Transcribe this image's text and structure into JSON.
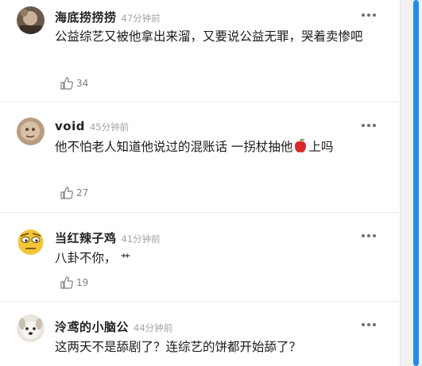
{
  "comments": [
    {
      "username": "海底捞捞捞",
      "time": "47分钟前",
      "text": "公益综艺又被他拿出来溜，又要说公益无罪，哭着卖惨吧",
      "likes": "34",
      "avatar_icon": "avatar-photo-icon"
    },
    {
      "username": "void",
      "time": "45分钟前",
      "text_before": "他不怕老人知道他说过的混账话 一拐杖抽他",
      "text_after": "上吗",
      "emoji": "apple-emoji",
      "likes": "27",
      "avatar_icon": "avatar-photo-icon"
    },
    {
      "username": "当红辣子鸡",
      "time": "41分钟前",
      "text": "八卦不你，",
      "text_extra": "艹",
      "likes": "19",
      "avatar_icon": "avatar-emoji-face-icon"
    },
    {
      "username": "泠鸢的小脑公",
      "time": "44分钟前",
      "text": "这两天不是舔剧了？连综艺的饼都开始舔了？",
      "avatar_icon": "avatar-dog-photo-icon"
    }
  ],
  "colors": {
    "username": "#222222",
    "time": "#a3a3a3",
    "text": "#1a1a1a",
    "like": "#7f7f7f",
    "divider": "#ebebeb",
    "scroll_thumb": "#1f8ef1"
  }
}
